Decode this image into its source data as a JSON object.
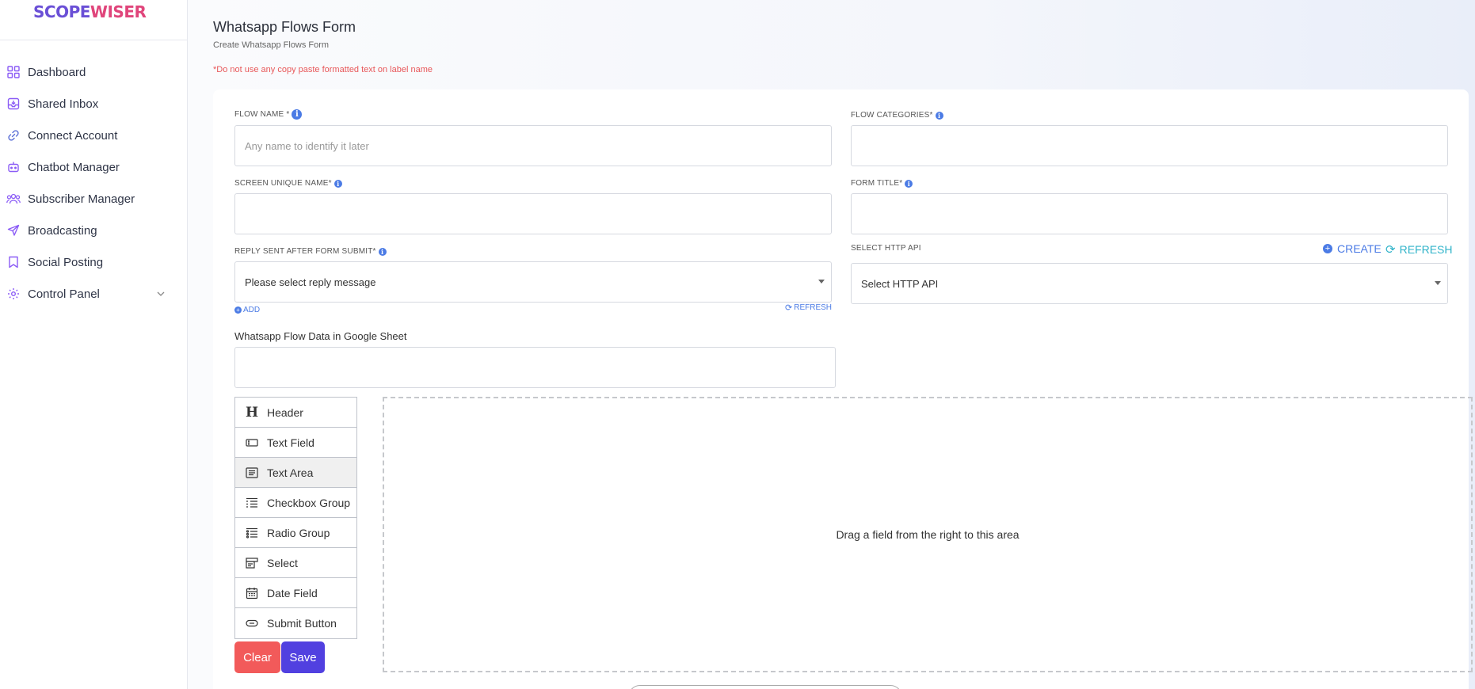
{
  "logo": {
    "part1": "SCOPE",
    "part2": "WISER"
  },
  "sidebar": {
    "items": [
      {
        "label": "Dashboard",
        "icon": "grid-icon",
        "color": "#8b5cf6"
      },
      {
        "label": "Shared Inbox",
        "icon": "inbox-icon",
        "color": "#8b5cf6"
      },
      {
        "label": "Connect Account",
        "icon": "link-icon",
        "color": "#5b6fd6"
      },
      {
        "label": "Chatbot Manager",
        "icon": "robot-icon",
        "color": "#8b5cf6"
      },
      {
        "label": "Subscriber Manager",
        "icon": "users-icon",
        "color": "#8b5cf6"
      },
      {
        "label": "Broadcasting",
        "icon": "send-icon",
        "color": "#8b5cf6"
      },
      {
        "label": "Social Posting",
        "icon": "bookmark-icon",
        "color": "#8b5cf6"
      },
      {
        "label": "Control Panel",
        "icon": "gear-icon",
        "color": "#8b5cf6",
        "has_chevron": true
      }
    ]
  },
  "page": {
    "title": "Whatsapp Flows Form",
    "subtitle": "Create Whatsapp Flows Form",
    "warning": "*Do not use any copy paste formatted text on label name"
  },
  "form": {
    "flow_name_label": "FLOW NAME *",
    "flow_name_placeholder": "Any name to identify it later",
    "flow_categories_label": "FLOW CATEGORIES*",
    "screen_unique_name_label": "SCREEN UNIQUE NAME*",
    "form_title_label": "FORM TITLE*",
    "reply_label": "REPLY SENT AFTER FORM SUBMIT*",
    "reply_value": "Please select reply message",
    "add_label": "ADD",
    "refresh_small_label": "REFRESH",
    "http_api_label": "SELECT HTTP API",
    "http_api_value": "Select HTTP API",
    "create_label": "CREATE",
    "refresh_label": "REFRESH",
    "google_sheet_label": "Whatsapp Flow Data in Google Sheet"
  },
  "palette": [
    {
      "label": "Header",
      "icon": "header-icon"
    },
    {
      "label": "Text Field",
      "icon": "text-field-icon"
    },
    {
      "label": "Text Area",
      "icon": "text-area-icon",
      "active": true
    },
    {
      "label": "Checkbox Group",
      "icon": "checkbox-group-icon"
    },
    {
      "label": "Radio Group",
      "icon": "radio-group-icon"
    },
    {
      "label": "Select",
      "icon": "select-icon"
    },
    {
      "label": "Date Field",
      "icon": "calendar-icon"
    },
    {
      "label": "Submit Button",
      "icon": "submit-button-icon"
    }
  ],
  "drop_area_text": "Drag a field from the right to this area",
  "buttons": {
    "clear": "Clear",
    "save": "Save"
  }
}
